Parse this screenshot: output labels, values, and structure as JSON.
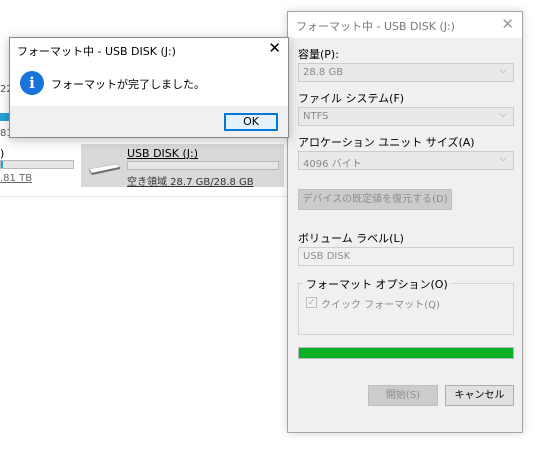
{
  "background": {
    "left_drive": {
      "label": ")",
      "size_text": ".81 TB",
      "used_fraction": 0.03
    },
    "usb_tile": {
      "name": "USB DISK (J:)",
      "free_text": "空き領域 28.7 GB/28.8 GB",
      "used_fraction": 0.0
    },
    "fragments": {
      "row1": "22",
      "row2": "81"
    }
  },
  "format_dialog": {
    "title": "フォーマット中 - USB DISK (J:)",
    "capacity_label": "容量(P):",
    "capacity_value": "28.8 GB",
    "filesystem_label": "ファイル システム(F)",
    "filesystem_value": "NTFS",
    "alloc_label": "アロケーション ユニット サイズ(A)",
    "alloc_value": "4096 バイト",
    "restore_button": "デバイスの既定値を復元する(D)",
    "volume_label": "ボリューム ラベル(L)",
    "volume_value": "USB DISK",
    "options_group": "フォーマット オプション(O)",
    "quick_format": "クイック フォーマット(Q)",
    "quick_format_checked": true,
    "progress_fraction": 1.0,
    "start_button": "開始(S)",
    "cancel_button": "キャンセル"
  },
  "message_box": {
    "title": "フォーマット中 - USB DISK (J:)",
    "message": "フォーマットが完了しました。",
    "ok_button": "OK",
    "icon": "info-icon"
  },
  "colors": {
    "progress_green": "#06b025",
    "info_blue": "#1a73d9",
    "focus_blue": "#0078d7"
  }
}
